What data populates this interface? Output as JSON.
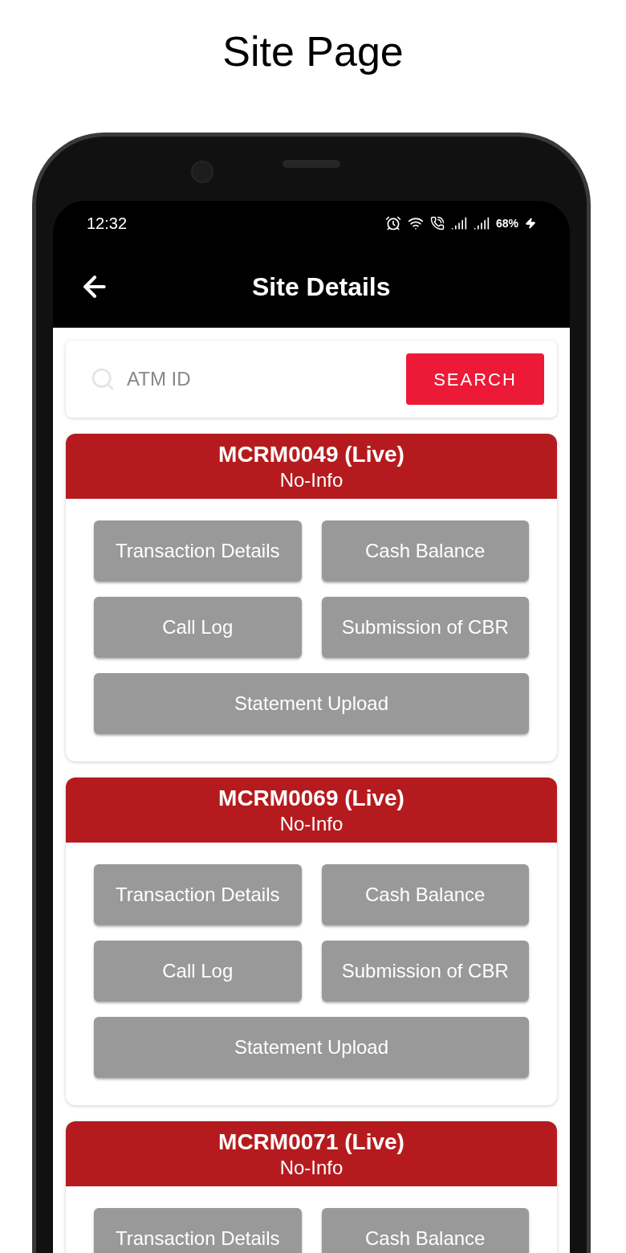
{
  "page_title": "Site Page",
  "status_bar": {
    "time": "12:32",
    "battery": "68%"
  },
  "app_bar": {
    "title": "Site Details"
  },
  "search": {
    "placeholder": "ATM ID",
    "button": "SEARCH"
  },
  "sites": [
    {
      "title": "MCRM0049 (Live)",
      "subtitle": "No-Info",
      "actions": [
        {
          "label": "Transaction Details",
          "wide": false
        },
        {
          "label": "Cash Balance",
          "wide": false
        },
        {
          "label": "Call Log",
          "wide": false
        },
        {
          "label": "Submission of CBR",
          "wide": false
        },
        {
          "label": "Statement Upload",
          "wide": true
        }
      ]
    },
    {
      "title": "MCRM0069 (Live)",
      "subtitle": "No-Info",
      "actions": [
        {
          "label": "Transaction Details",
          "wide": false
        },
        {
          "label": "Cash Balance",
          "wide": false
        },
        {
          "label": "Call Log",
          "wide": false
        },
        {
          "label": "Submission of CBR",
          "wide": false
        },
        {
          "label": "Statement Upload",
          "wide": true
        }
      ]
    },
    {
      "title": "MCRM0071 (Live)",
      "subtitle": "No-Info",
      "actions": [
        {
          "label": "Transaction Details",
          "wide": false
        },
        {
          "label": "Cash Balance",
          "wide": false
        }
      ]
    }
  ]
}
